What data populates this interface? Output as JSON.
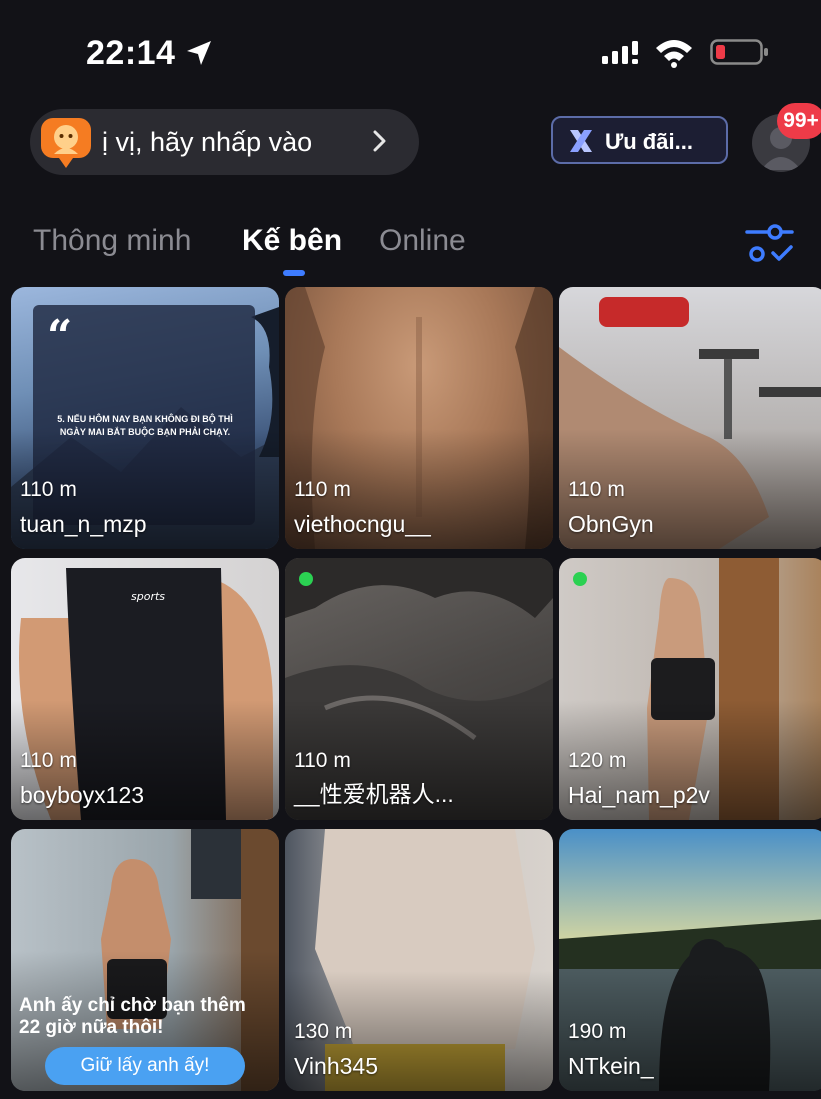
{
  "status_bar": {
    "time": "22:14",
    "icons": [
      "location-arrow-icon",
      "cellular-signal-icon",
      "wifi-icon",
      "battery-low-icon"
    ],
    "battery_color": "#ee3b48"
  },
  "header": {
    "promo_text": "ị vị, hãy nhấp vào",
    "promo_icon": "chat-avatar-icon",
    "offer_label": "Ưu đãi...",
    "offer_icon": "x-logo-icon",
    "notification_count": "99+"
  },
  "tabs": [
    {
      "label": "Thông minh",
      "active": false
    },
    {
      "label": "Kế bên",
      "active": true
    },
    {
      "label": "Online",
      "active": false
    }
  ],
  "colors": {
    "background": "#121217",
    "accent": "#3e7cff",
    "online": "#2bd152",
    "badge": "#ee3b48",
    "cta": "#4aa1f2"
  },
  "users": [
    {
      "distance": "110 m",
      "name": "tuan_n_mzp",
      "online": false
    },
    {
      "distance": "110 m",
      "name": "viethocngu__",
      "online": false
    },
    {
      "distance": "110 m",
      "name": "ObnGyn",
      "online": false
    },
    {
      "distance": "110 m",
      "name": "boyboyx123",
      "online": false
    },
    {
      "distance": "110 m",
      "name": "__性爱机器人...",
      "online": true
    },
    {
      "distance": "120 m",
      "name": "Hai_nam_p2v",
      "online": true
    },
    {
      "distance": "",
      "name": "",
      "online": false
    },
    {
      "distance": "130 m",
      "name": "Vinh345",
      "online": false
    },
    {
      "distance": "190 m",
      "name": "NTkein_",
      "online": false
    }
  ],
  "quote_card": {
    "text": "5. NẾU HÔM NAY BẠN KHÔNG ĐI BỘ THÌ NGÀY MAI BẮT BUỘC BẠN PHẢI CHẠY."
  },
  "cta_card": {
    "message": "Anh ấy chỉ chờ bạn thêm 22 giờ nữa thôi!",
    "button_label": "Giữ lấy anh ấy!"
  }
}
